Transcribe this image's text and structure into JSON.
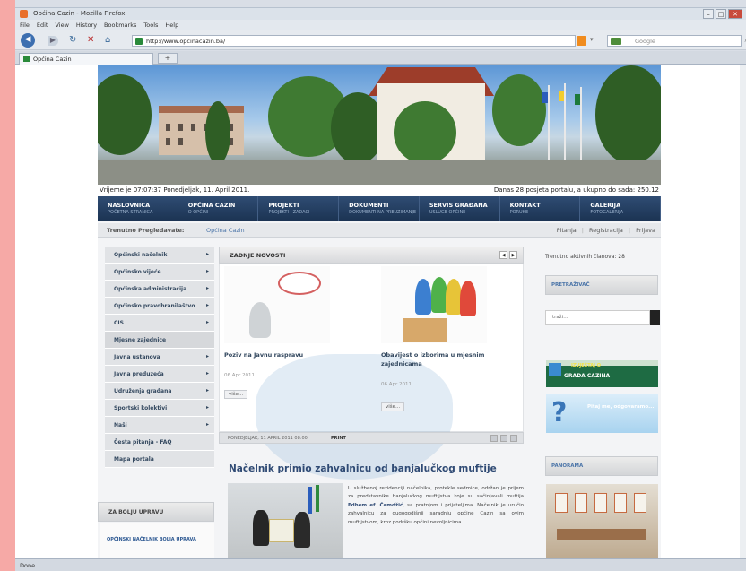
{
  "window": {
    "title": "Općina Cazin - Mozilla Firefox"
  },
  "menubar": [
    "File",
    "Edit",
    "View",
    "History",
    "Bookmarks",
    "Tools",
    "Help"
  ],
  "toolbar": {
    "url": "http://www.opcinacazin.ba/",
    "search_placeholder": "Google"
  },
  "tab": {
    "label": "Općina Cazin",
    "new_tab": "+"
  },
  "ticker": {
    "left": "Vrijeme je 07:07:37 Ponedjeljak, 11. April 2011.",
    "right": "Danas 28 posjeta portalu, a ukupno do sada: 250.12"
  },
  "mainnav": [
    {
      "title": "NASLOVNICA",
      "sub": "POČETNA STRANICA"
    },
    {
      "title": "OPĆINA CAZIN",
      "sub": "O OPĆINI"
    },
    {
      "title": "PROJEKTI",
      "sub": "PROJEKTI I ZADACI"
    },
    {
      "title": "DOKUMENTI",
      "sub": "DOKUMENTI NA PREUZIMANJE"
    },
    {
      "title": "SERVIS GRAĐANA",
      "sub": "USLUGE OPĆINE"
    },
    {
      "title": "KONTAKT",
      "sub": "PORUKE"
    },
    {
      "title": "GALERIJA",
      "sub": "FOTOGALERIJA"
    }
  ],
  "crumb": {
    "label": "Trenutno Pregledavate:",
    "value": "Općina Cazin",
    "links": [
      "Pitanja",
      "Registracija",
      "Prijava"
    ]
  },
  "leftmenu": [
    {
      "label": "Općinski načelnik",
      "arrow": "▸"
    },
    {
      "label": "Općinsko vijeće",
      "arrow": "▸"
    },
    {
      "label": "Općinska administracija",
      "arrow": "▸"
    },
    {
      "label": "Općinsko pravobranilaštvo",
      "arrow": "▸"
    },
    {
      "label": "CIS",
      "arrow": "▸"
    },
    {
      "label": "Mjesne zajednice",
      "arrow": ""
    },
    {
      "label": "Javna ustanova",
      "arrow": "▸"
    },
    {
      "label": "Javna preduzeća",
      "arrow": "▸"
    },
    {
      "label": "Udruženja građana",
      "arrow": "▸"
    },
    {
      "label": "Sportski kolektivi",
      "arrow": "▸"
    },
    {
      "label": "Naši",
      "arrow": "▸"
    },
    {
      "label": "Česta pitanja - FAQ",
      "arrow": ""
    },
    {
      "label": "Mapa portala",
      "arrow": ""
    }
  ],
  "bolji": {
    "label": "ZA BOLJU UPRAVU",
    "image_text": "OPĆINSKI NAČELNIK   BOLJA UPRAVA"
  },
  "news": {
    "header": "ZADNJE NOVOSTI",
    "articles": [
      {
        "title": "Poziv na Javnu raspravu",
        "date": "06 Apr 2011",
        "more": "više..."
      },
      {
        "title": "Obavijest o izborima u mjesnim zajednicama",
        "date": "06 Apr 2011",
        "more": "više..."
      }
    ],
    "footer_date": "PONEDJELJAK, 11 APRIL 2011 08:00",
    "footer_print": "PRINT"
  },
  "feature": {
    "headline": "Načelnik primio zahvalnicu od banjalučkog muftije",
    "text_intro": "U službenoj rezidenciji načelnika, protekle sedmice, održan je prijem za predstavnike banjalučkog muftijstva koje su sačinjavali muftija",
    "text_bold": "Edhem ef. Čamdžić",
    "text_rest": ", sa pratnjom i prijateljima. Načelnik je uručio zahvalnicu za dugogodišnji saradnju općine Cazin sa ovim muftijstvom, kroz podršku općini nevoljnicima."
  },
  "right": {
    "online": "Trenutno aktivnih članova: 28",
    "search_header": "PRETRAŽIVAČ",
    "search_placeholder": "traži...",
    "izbori_l1": "IZVJEŠTAJ O",
    "izbori_l2": "GRADA CAZINA",
    "pitaj_text": "Pitaj me, odgovaramo...",
    "panorama_header": "PANORAMA"
  },
  "status": {
    "text": "Done"
  }
}
